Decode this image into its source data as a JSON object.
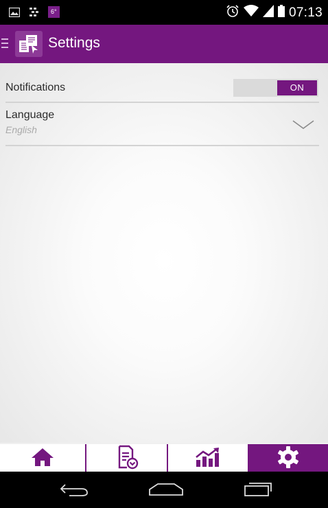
{
  "status_bar": {
    "temperature": "6°",
    "time": "07:13",
    "icons": [
      "image-icon",
      "bbm-icon",
      "alarm-clock-icon",
      "wifi-icon",
      "signal-icon",
      "battery-icon"
    ]
  },
  "app_bar": {
    "title": "Settings",
    "icons": [
      "hamburger-icon",
      "app-logo-icon"
    ]
  },
  "settings": {
    "notifications": {
      "label": "Notifications",
      "toggle_state": "ON",
      "enabled": true
    },
    "language": {
      "label": "Language",
      "value": "English",
      "icon": "chevron-down-icon"
    }
  },
  "tab_bar": {
    "tabs": [
      {
        "name": "home",
        "icon": "home-icon",
        "active": false
      },
      {
        "name": "documents",
        "icon": "document-icon",
        "active": false
      },
      {
        "name": "stats",
        "icon": "chart-icon",
        "active": false
      },
      {
        "name": "settings",
        "icon": "gear-icon",
        "active": true
      }
    ]
  },
  "nav_bar": {
    "buttons": [
      "back-icon",
      "home-outline-icon",
      "recent-apps-icon"
    ]
  },
  "colors": {
    "primary": "#74177f",
    "status_bar": "#000000",
    "toggle_off": "#dadada",
    "divider": "#d3d3d3",
    "secondary_text": "#aaaaaa"
  }
}
